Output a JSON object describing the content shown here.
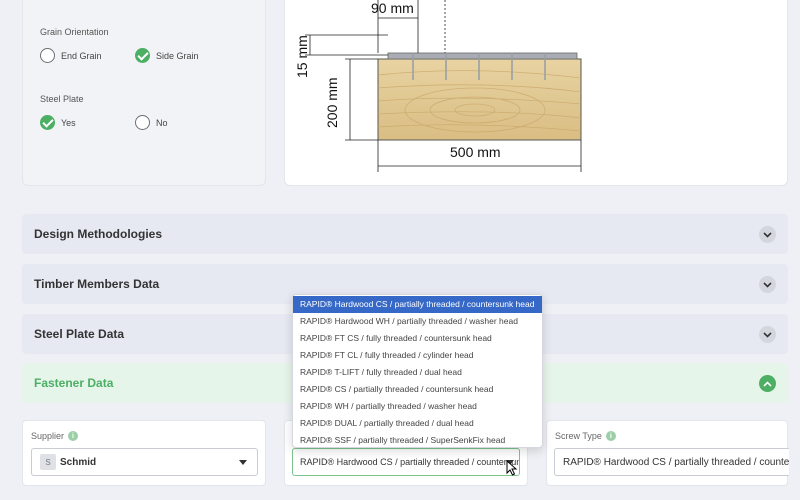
{
  "grain_orientation": {
    "label": "Grain Orientation",
    "options": [
      {
        "label": "End Grain",
        "checked": false
      },
      {
        "label": "Side Grain",
        "checked": true
      }
    ]
  },
  "steel_plate_option": {
    "label": "Steel Plate",
    "options": [
      {
        "label": "Yes",
        "checked": true
      },
      {
        "label": "No",
        "checked": false
      }
    ]
  },
  "drawing": {
    "dim_plate_width": "90 mm",
    "dim_plate_thickness": "15 mm",
    "dim_timber_height": "200 mm",
    "dim_timber_width": "500 mm"
  },
  "sections": [
    {
      "title": "Design Methodologies",
      "expanded": false
    },
    {
      "title": "Timber Members Data",
      "expanded": false
    },
    {
      "title": "Steel Plate Data",
      "expanded": false
    },
    {
      "title": "Fastener Data",
      "expanded": true
    }
  ],
  "fastener": {
    "supplier_label": "Supplier",
    "supplier_value": "Schmid",
    "supplier_avatar": "S",
    "product_value": "RAPID® Hardwood CS / partially threaded / countersunk head",
    "screw_type_label": "Screw Type",
    "screw_type_value": "RAPID® Hardwood CS / partially threaded / countersunk head"
  },
  "dropdown_options": [
    "RAPID® Hardwood CS / partially threaded / countersunk head",
    "RAPID® Hardwood WH / partially threaded / washer head",
    "RAPID® FT CS / fully threaded / countersunk head",
    "RAPID® FT CL / fully threaded / cylinder head",
    "RAPID® T-LIFT / fully threaded / dual head",
    "RAPID® CS / partially threaded / countersunk head",
    "RAPID® WH / partially threaded / washer head",
    "RAPID® DUAL / partially threaded / dual head",
    "RAPID® SSF / partially threaded / SuperSenkFix head"
  ],
  "colors": {
    "accent": "#4caf63",
    "selection": "#3568c7"
  }
}
